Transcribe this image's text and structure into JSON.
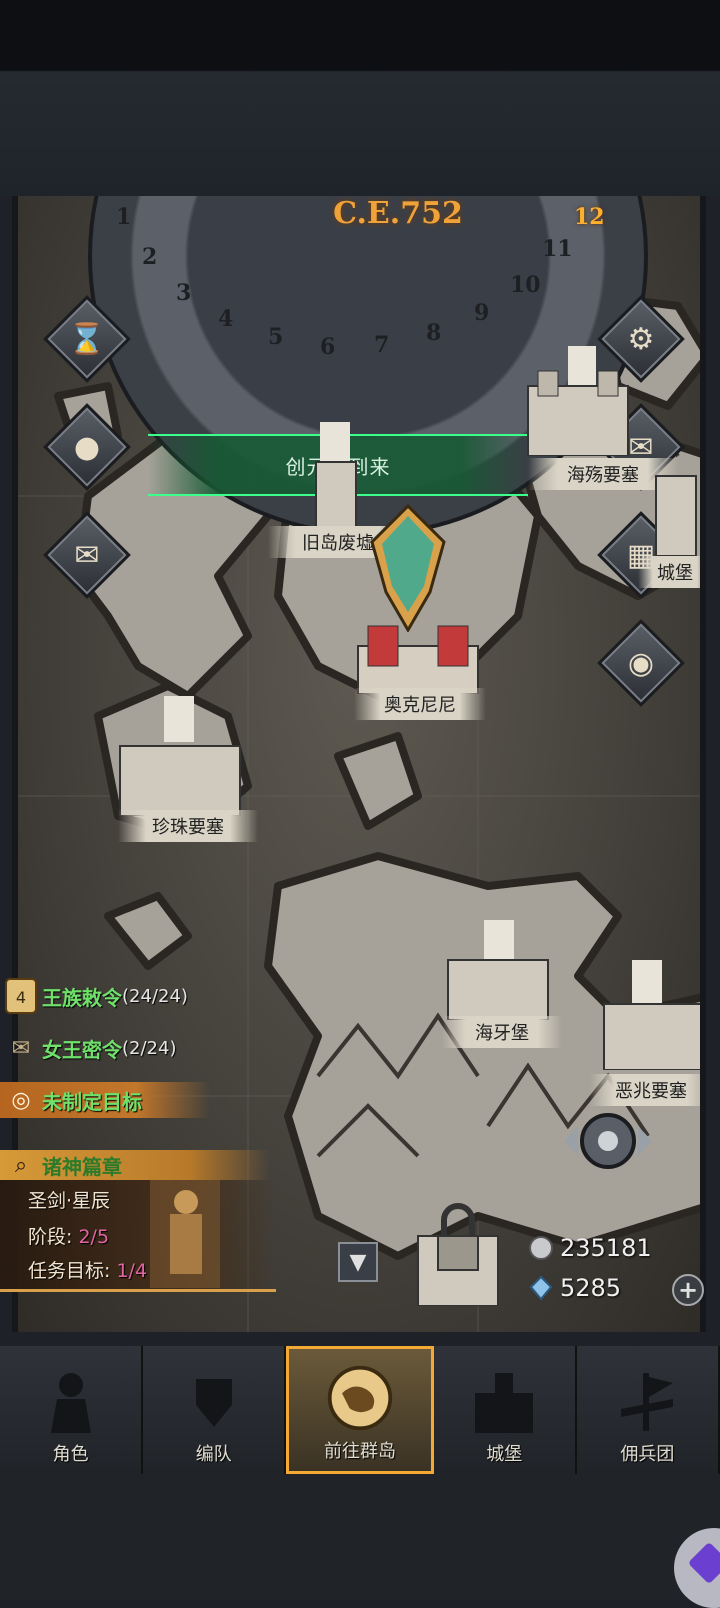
{
  "calendar": {
    "year_label": "C.E.752",
    "months": [
      "1",
      "2",
      "3",
      "4",
      "5",
      "6",
      "7",
      "8",
      "9",
      "10",
      "11",
      "12"
    ],
    "current_month": "12"
  },
  "side_buttons": {
    "left": [
      "hourglass-icon",
      "money-bag-icon",
      "scroll-icon"
    ],
    "right": [
      "settings-gear-icon",
      "mail-icon",
      "castle-gate-icon",
      "coin-icon"
    ]
  },
  "event_banner": "创元节到来",
  "locations": [
    {
      "name": "旧岛废墟"
    },
    {
      "name": "海殇要塞"
    },
    {
      "name": "城堡"
    },
    {
      "name": "奥克尼尼"
    },
    {
      "name": "珍珠要塞"
    },
    {
      "name": "海牙堡"
    },
    {
      "name": "恶兆要塞"
    }
  ],
  "quests": {
    "royal_decree": {
      "label": "王族敕令",
      "count": "(24/24)",
      "badge": "4"
    },
    "queen_order": {
      "label": "女王密令",
      "count": "(2/24)"
    },
    "goal": "未制定目标",
    "chapter_title": "诸神篇章",
    "chapter_name": "圣剑·星辰",
    "stage_label": "阶段:",
    "stage_value": "2/5",
    "task_label": "任务目标:",
    "task_value": "1/4"
  },
  "currency": {
    "silver": "235181",
    "crystal": "5285"
  },
  "nav": {
    "items": [
      {
        "label": "角色"
      },
      {
        "label": "编队"
      },
      {
        "label": "前往群岛"
      },
      {
        "label": "城堡"
      },
      {
        "label": "佣兵团"
      }
    ],
    "active_index": 2
  },
  "colors": {
    "accent_gold": "#f3a934",
    "quest_green": "#6fe06a",
    "banner_green": "#3dff8c",
    "progress_pink": "#e064a0"
  }
}
